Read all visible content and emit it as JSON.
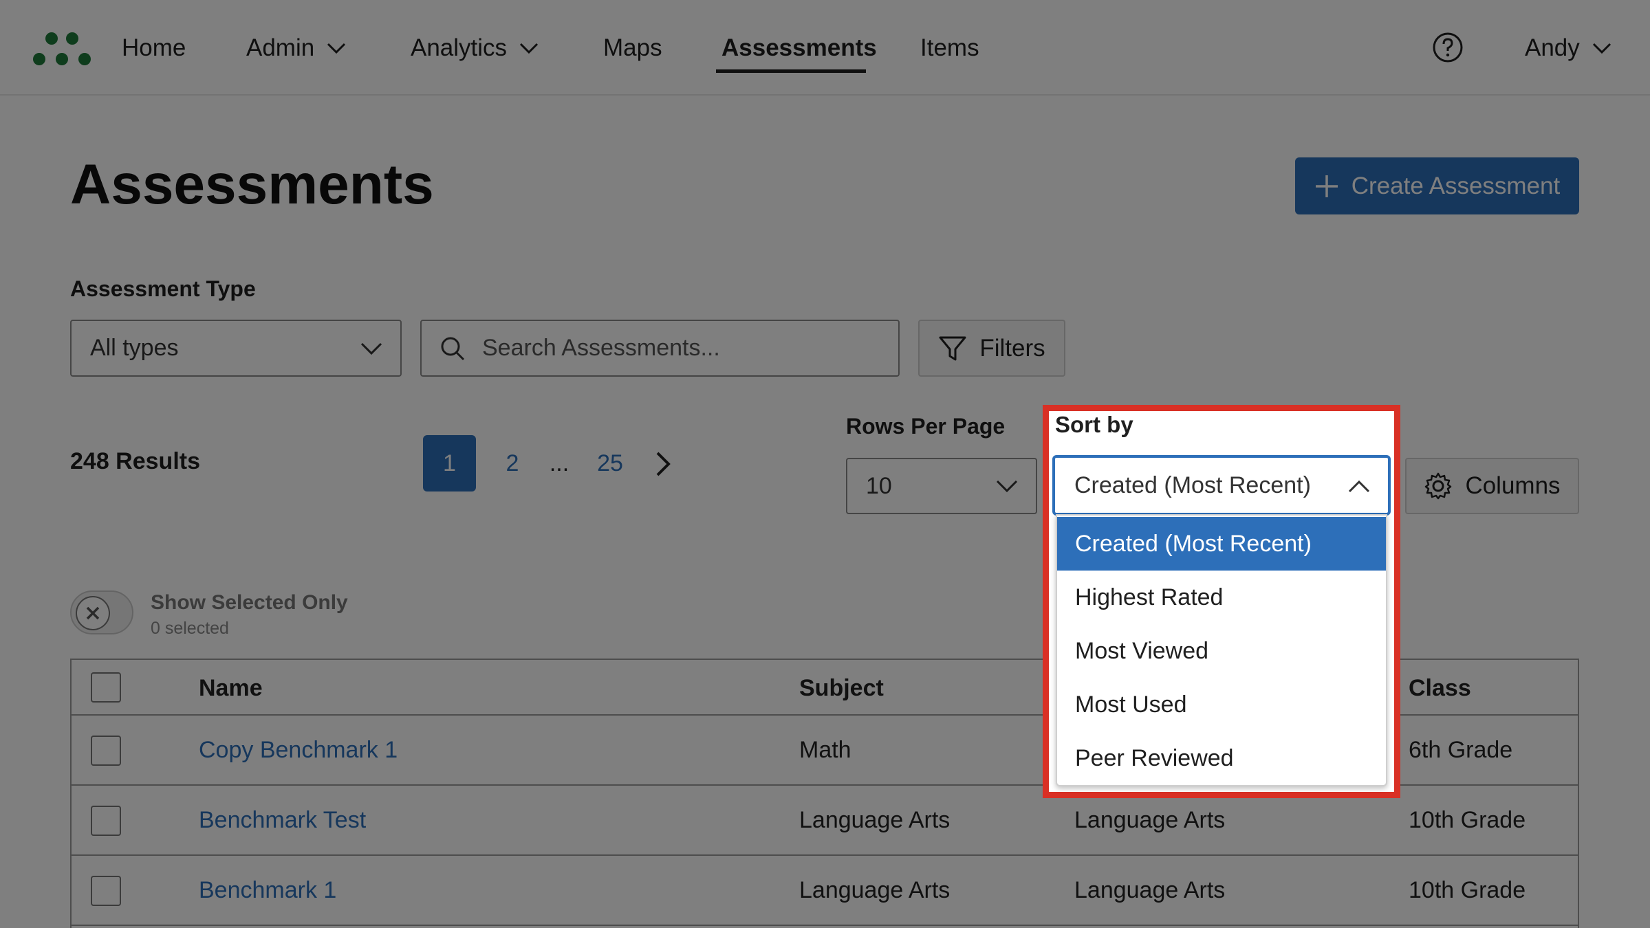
{
  "nav": {
    "items": [
      {
        "label": "Home"
      },
      {
        "label": "Admin"
      },
      {
        "label": "Analytics"
      },
      {
        "label": "Maps"
      },
      {
        "label": "Assessments"
      },
      {
        "label": "Items"
      }
    ],
    "user": "Andy"
  },
  "page": {
    "title": "Assessments",
    "create_label": "Create Assessment"
  },
  "filters": {
    "type_label": "Assessment Type",
    "type_value": "All types",
    "search_placeholder": "Search Assessments...",
    "filters_label": "Filters"
  },
  "results": {
    "count_label": "248 Results",
    "pages": [
      "1",
      "2",
      "...",
      "25"
    ],
    "current_page": "1"
  },
  "rows_per_page": {
    "label": "Rows Per Page",
    "value": "10"
  },
  "sort": {
    "label": "Sort by",
    "value": "Created (Most Recent)",
    "options": [
      "Created (Most Recent)",
      "Highest Rated",
      "Most Viewed",
      "Most Used",
      "Peer Reviewed"
    ]
  },
  "columns_label": "Columns",
  "selection": {
    "label": "Show Selected Only",
    "count": "0 selected"
  },
  "table": {
    "headers": {
      "name": "Name",
      "subject": "Subject",
      "class": "Class"
    },
    "rows": [
      {
        "name": "Copy Benchmark 1",
        "subject": "Math",
        "subject2": "",
        "class": "6th Grade"
      },
      {
        "name": "Benchmark Test",
        "subject": "Language Arts",
        "subject2": "Language Arts",
        "class": "10th Grade"
      },
      {
        "name": "Benchmark 1",
        "subject": "Language Arts",
        "subject2": "Language Arts",
        "class": "10th Grade"
      }
    ]
  },
  "colors": {
    "accent": "#2d6fb9",
    "highlight": "#d93025",
    "logo": "#1f7a3a"
  }
}
